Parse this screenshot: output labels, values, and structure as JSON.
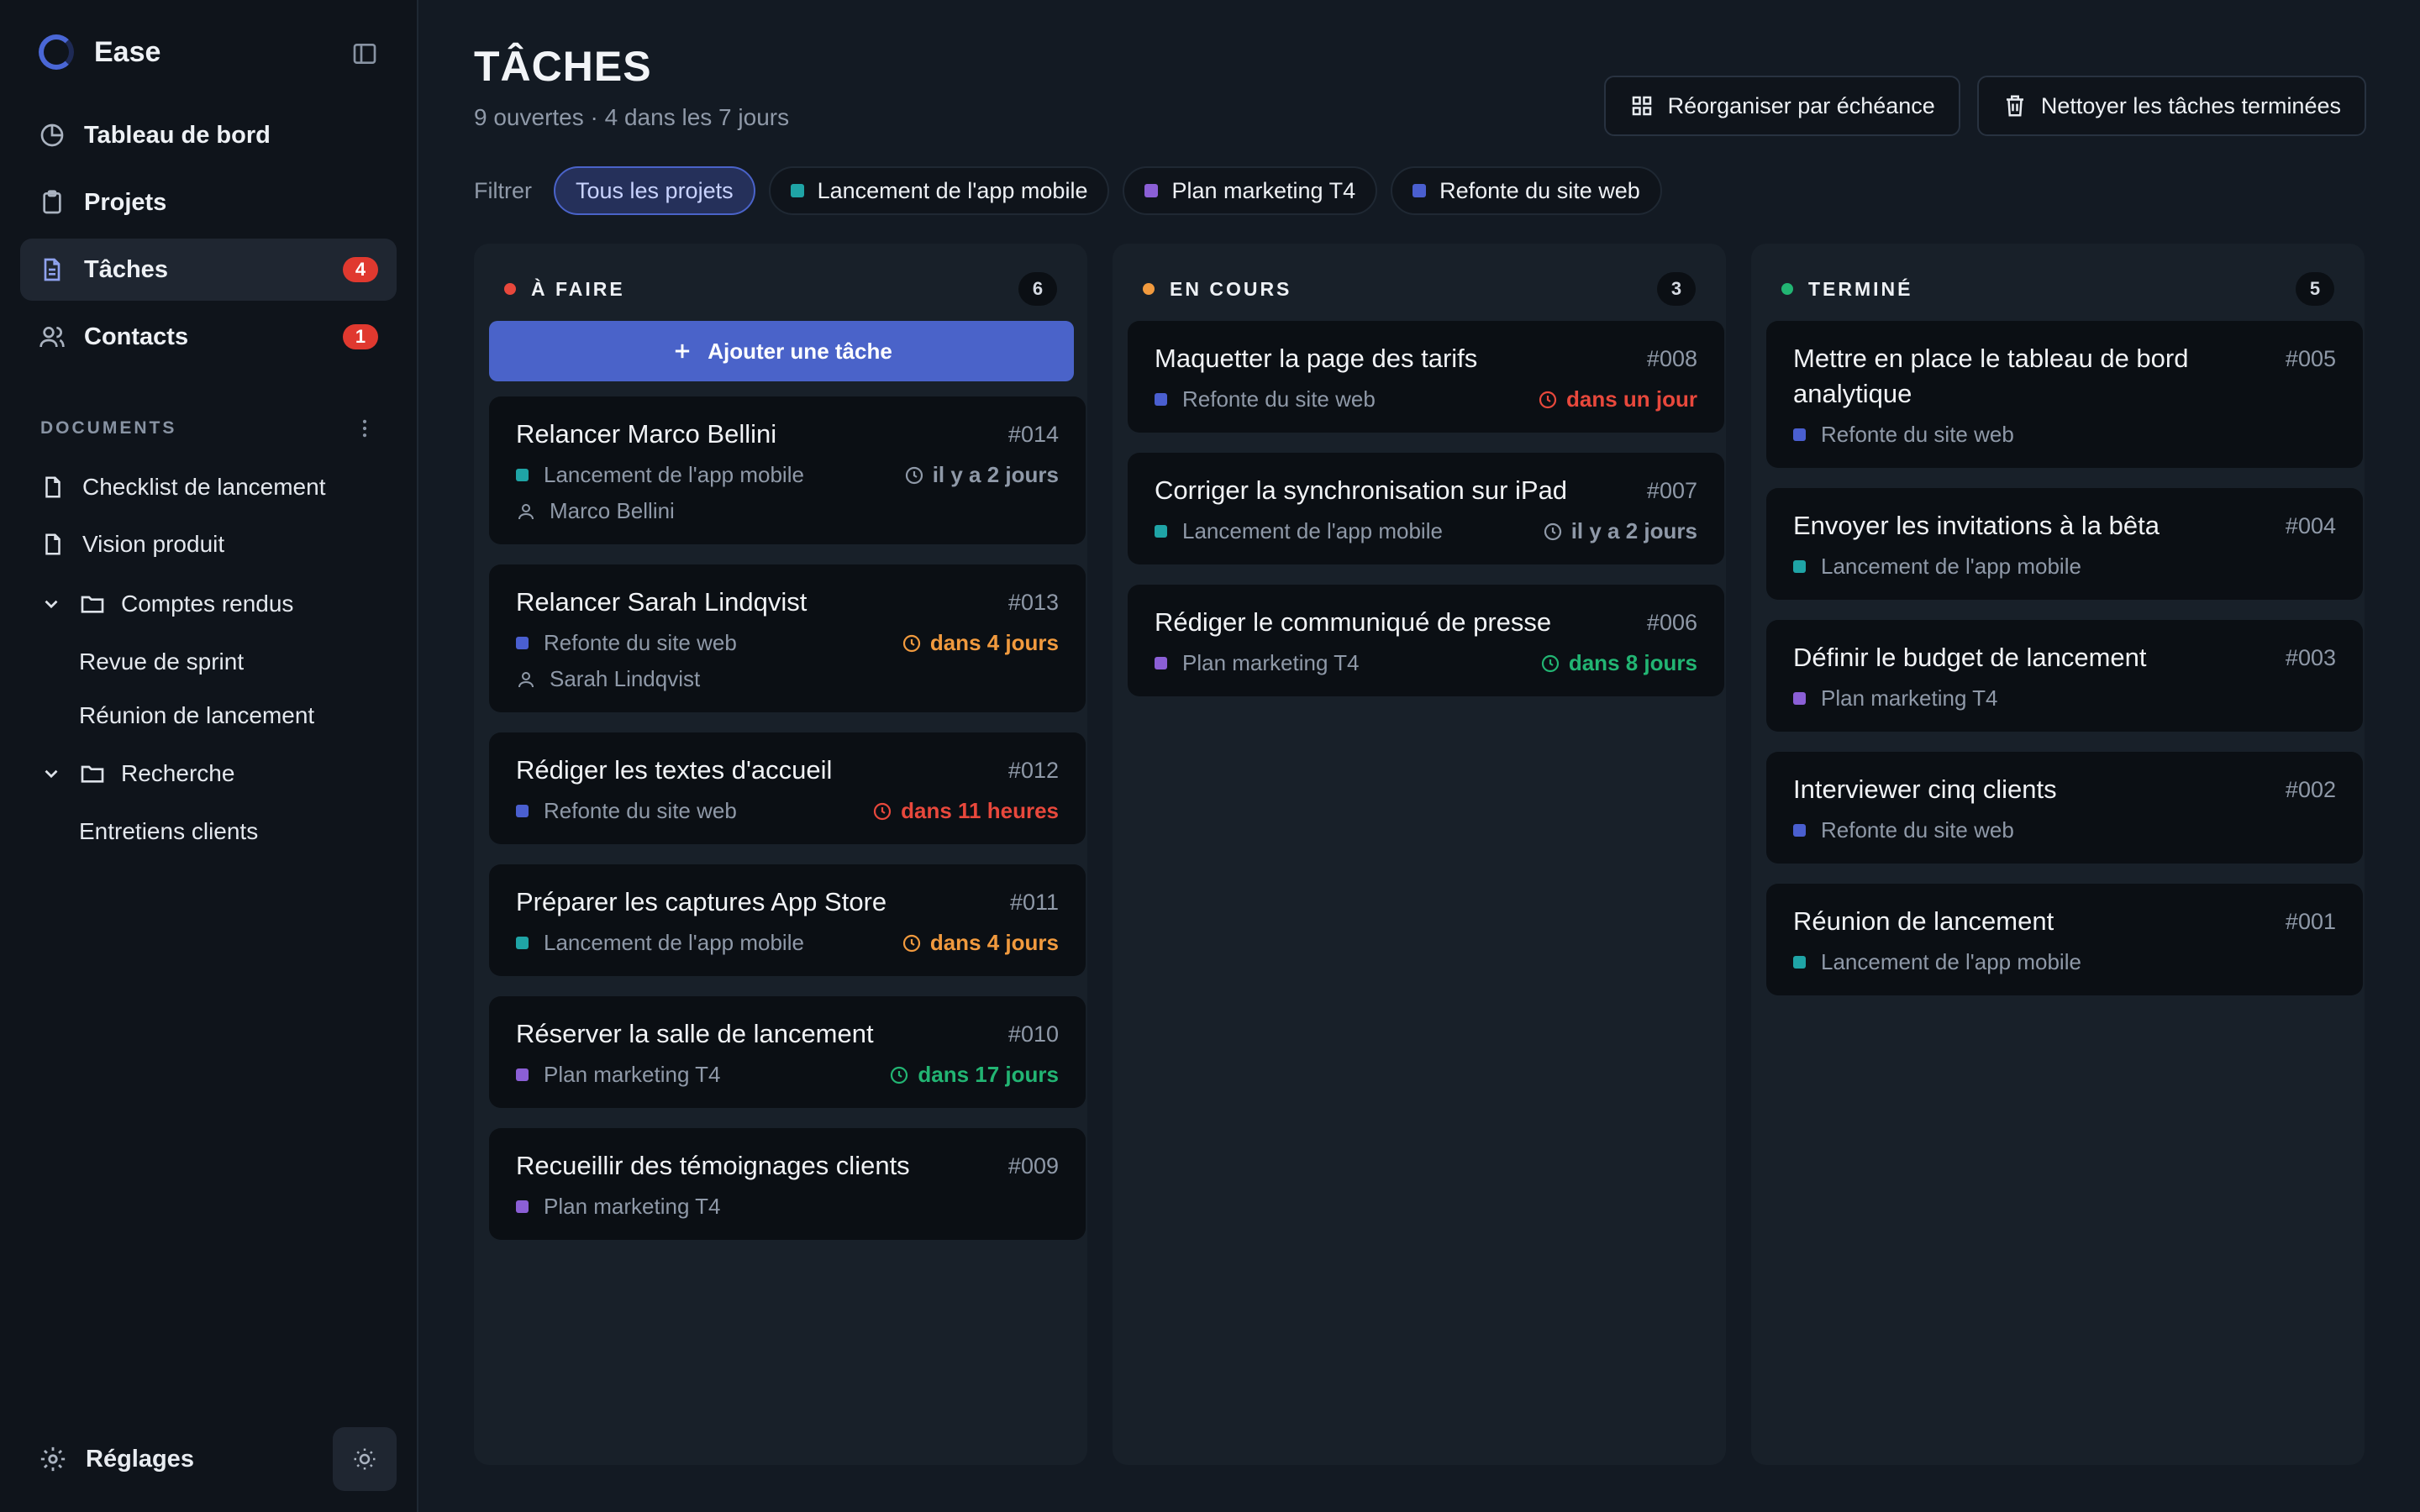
{
  "app": {
    "name": "Ease"
  },
  "colors": {
    "accent": "#4a63c9",
    "teal": "#1fa4a6",
    "purple": "#8b5fd6",
    "blue": "#4a5fd0",
    "red": "#e8483c",
    "orange": "#f19a3e",
    "green": "#22b573"
  },
  "sidebar": {
    "nav": [
      {
        "label": "Tableau de bord",
        "icon": "dashboard-icon",
        "badge": ""
      },
      {
        "label": "Projets",
        "icon": "clipboard-icon",
        "badge": ""
      },
      {
        "label": "Tâches",
        "icon": "document-icon",
        "badge": "4",
        "active": true
      },
      {
        "label": "Contacts",
        "icon": "users-icon",
        "badge": "1"
      }
    ],
    "documents_header": "DOCUMENTS",
    "documents": [
      {
        "label": "Checklist de lancement"
      },
      {
        "label": "Vision produit"
      }
    ],
    "folders": [
      {
        "label": "Comptes rendus",
        "children": [
          "Revue de sprint",
          "Réunion de lancement"
        ]
      },
      {
        "label": "Recherche",
        "children": [
          "Entretiens clients"
        ]
      }
    ],
    "settings_label": "Réglages"
  },
  "header": {
    "title": "TÂCHES",
    "subtitle": "9 ouvertes · 4 dans les 7 jours",
    "actions": {
      "reorganize": "Réorganiser par échéance",
      "clean": "Nettoyer les tâches terminées"
    }
  },
  "filters": {
    "label": "Filtrer",
    "chips": [
      {
        "label": "Tous les projets",
        "active": true
      },
      {
        "label": "Lancement de l'app mobile",
        "color": "teal"
      },
      {
        "label": "Plan marketing T4",
        "color": "purple"
      },
      {
        "label": "Refonte du site web",
        "color": "blue"
      }
    ]
  },
  "board": {
    "add_task_label": "Ajouter une tâche",
    "columns": [
      {
        "title": "À FAIRE",
        "count": "6",
        "dot": "red",
        "cards": [
          {
            "title": "Relancer Marco Bellini",
            "id": "#014",
            "project": "Lancement de l'app mobile",
            "project_color": "teal",
            "due": "il y a 2 jours",
            "due_color": "gray",
            "assignee": "Marco Bellini"
          },
          {
            "title": "Relancer Sarah Lindqvist",
            "id": "#013",
            "project": "Refonte du site web",
            "project_color": "blue",
            "due": "dans 4 jours",
            "due_color": "orange",
            "assignee": "Sarah Lindqvist"
          },
          {
            "title": "Rédiger les textes d'accueil",
            "id": "#012",
            "project": "Refonte du site web",
            "project_color": "blue",
            "due": "dans 11 heures",
            "due_color": "red"
          },
          {
            "title": "Préparer les captures App Store",
            "id": "#011",
            "project": "Lancement de l'app mobile",
            "project_color": "teal",
            "due": "dans 4 jours",
            "due_color": "orange"
          },
          {
            "title": "Réserver la salle de lancement",
            "id": "#010",
            "project": "Plan marketing T4",
            "project_color": "purple",
            "due": "dans 17 jours",
            "due_color": "green"
          },
          {
            "title": "Recueillir des témoignages clients",
            "id": "#009",
            "project": "Plan marketing T4",
            "project_color": "purple"
          }
        ]
      },
      {
        "title": "EN COURS",
        "count": "3",
        "dot": "orange",
        "cards": [
          {
            "title": "Maquetter la page des tarifs",
            "id": "#008",
            "project": "Refonte du site web",
            "project_color": "blue",
            "due": "dans un jour",
            "due_color": "red"
          },
          {
            "title": "Corriger la synchronisation sur iPad",
            "id": "#007",
            "project": "Lancement de l'app mobile",
            "project_color": "teal",
            "due": "il y a 2 jours",
            "due_color": "gray"
          },
          {
            "title": "Rédiger le communiqué de presse",
            "id": "#006",
            "project": "Plan marketing T4",
            "project_color": "purple",
            "due": "dans 8 jours",
            "due_color": "green"
          }
        ]
      },
      {
        "title": "TERMINÉ",
        "count": "5",
        "dot": "green",
        "cards": [
          {
            "title": "Mettre en place le tableau de bord analytique",
            "id": "#005",
            "project": "Refonte du site web",
            "project_color": "blue"
          },
          {
            "title": "Envoyer les invitations à la bêta",
            "id": "#004",
            "project": "Lancement de l'app mobile",
            "project_color": "teal"
          },
          {
            "title": "Définir le budget de lancement",
            "id": "#003",
            "project": "Plan marketing T4",
            "project_color": "purple"
          },
          {
            "title": "Interviewer cinq clients",
            "id": "#002",
            "project": "Refonte du site web",
            "project_color": "blue"
          },
          {
            "title": "Réunion de lancement",
            "id": "#001",
            "project": "Lancement de l'app mobile",
            "project_color": "teal"
          }
        ]
      }
    ]
  }
}
